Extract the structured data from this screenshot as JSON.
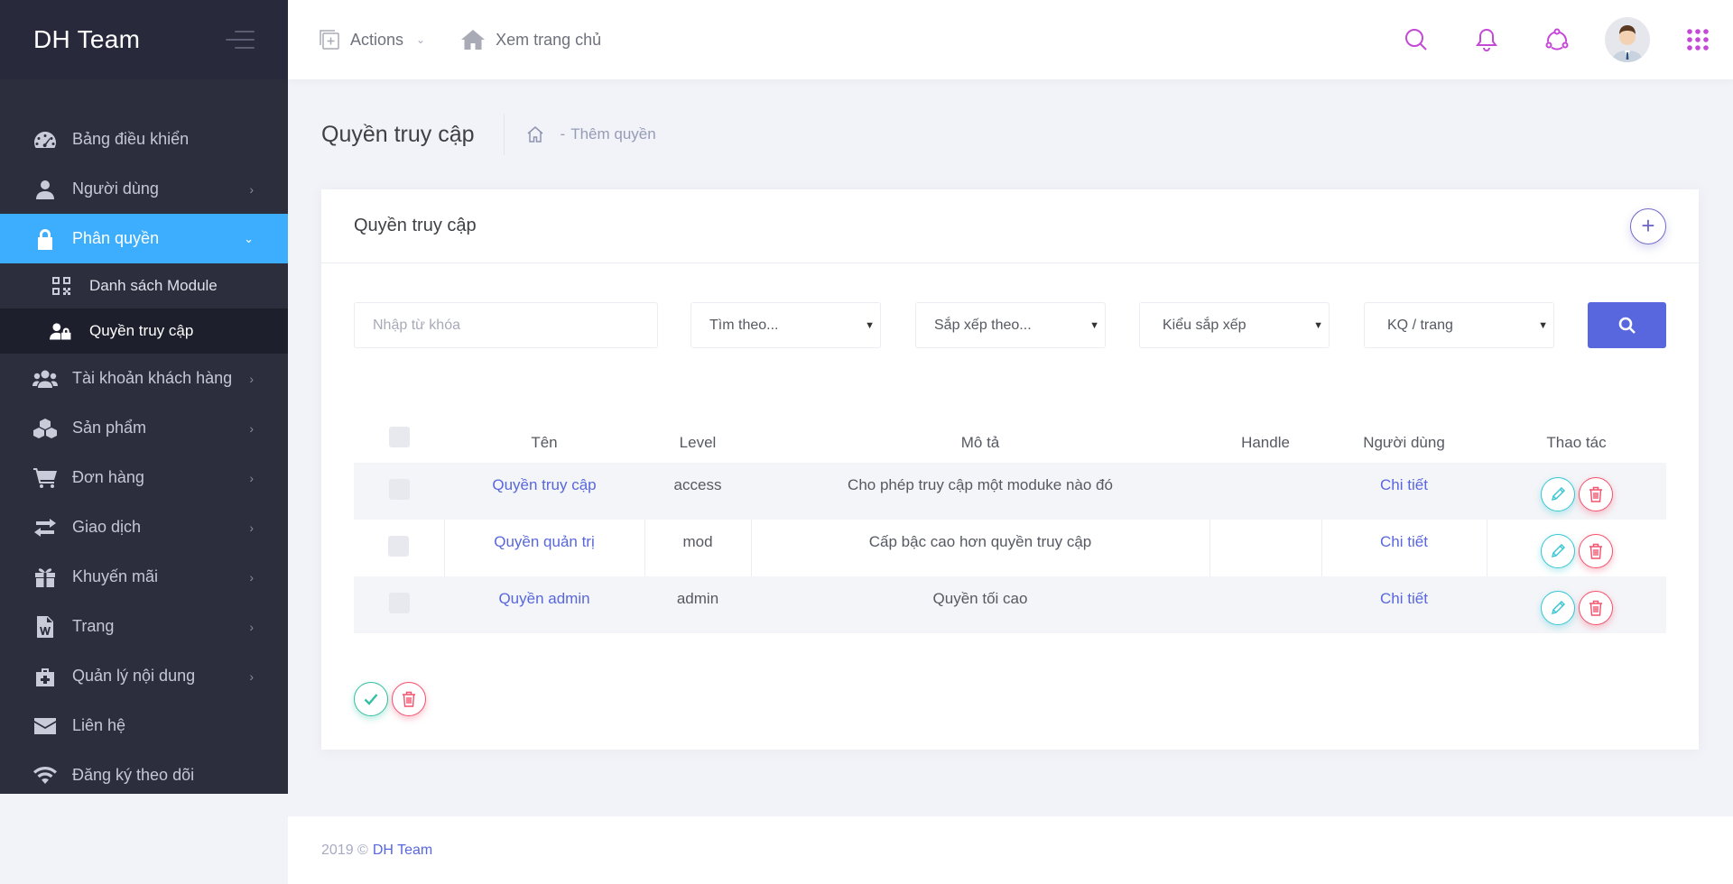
{
  "brand": {
    "name": "DH Team"
  },
  "header": {
    "actions_label": "Actions",
    "home_link_label": "Xem trang chủ"
  },
  "sidebar": {
    "items": [
      {
        "label": "Bảng điều khiển",
        "icon": "dashboard-icon",
        "has_arrow": false
      },
      {
        "label": "Người dùng",
        "icon": "user-icon",
        "has_arrow": true
      },
      {
        "label": "Phân quyền",
        "icon": "lock-icon",
        "has_arrow": true,
        "active": true,
        "children": [
          {
            "label": "Danh sách Module",
            "icon": "qrcode-icon"
          },
          {
            "label": "Quyền truy cập",
            "icon": "user-lock-icon",
            "active": true
          }
        ]
      },
      {
        "label": "Tài khoản khách hàng",
        "icon": "users-icon",
        "has_arrow": true
      },
      {
        "label": "Sản phẩm",
        "icon": "cubes-icon",
        "has_arrow": true
      },
      {
        "label": "Đơn hàng",
        "icon": "cart-icon",
        "has_arrow": true
      },
      {
        "label": "Giao dịch",
        "icon": "exchange-icon",
        "has_arrow": true
      },
      {
        "label": "Khuyến mãi",
        "icon": "gift-icon",
        "has_arrow": true
      },
      {
        "label": "Trang",
        "icon": "word-file-icon",
        "has_arrow": true
      },
      {
        "label": "Quản lý nội dung",
        "icon": "medkit-icon",
        "has_arrow": true
      },
      {
        "label": "Liên hệ",
        "icon": "envelope-icon",
        "has_arrow": false
      },
      {
        "label": "Đăng ký theo dõi",
        "icon": "wifi-icon",
        "has_arrow": false
      }
    ]
  },
  "subheader": {
    "title": "Quyền truy cập",
    "separator": "-",
    "breadcrumb": "Thêm quyền"
  },
  "portlet": {
    "title": "Quyền truy cập",
    "add_symbol": "+"
  },
  "filters": {
    "keyword_placeholder": "Nhập từ khóa",
    "search_by": "Tìm theo...",
    "sort_by": "Sắp xếp theo...",
    "sort_type": "Kiểu sắp xếp",
    "per_page": "KQ / trang"
  },
  "table": {
    "columns": [
      "Tên",
      "Level",
      "Mô tả",
      "Handle",
      "Người dùng",
      "Thao tác"
    ],
    "rows": [
      {
        "name": "Quyền truy cập",
        "level": "access",
        "description": "Cho phép truy cập một moduke nào đó",
        "handle": "",
        "users": "Chi tiết"
      },
      {
        "name": "Quyền quản trị",
        "level": "mod",
        "description": "Cấp bậc cao hơn quyền truy cập",
        "handle": "",
        "users": "Chi tiết"
      },
      {
        "name": "Quyền admin",
        "level": "admin",
        "description": "Quyền tối cao",
        "handle": "",
        "users": "Chi tiết"
      }
    ]
  },
  "footer": {
    "copyright": "2019 ©",
    "link": "DH Team"
  },
  "colors": {
    "sidebar_bg": "#2c2e3e",
    "active_item": "#3daefe",
    "primary": "#5867dd",
    "info": "#36c6d3",
    "danger": "#f4516c",
    "success": "#34bfa3",
    "header_icons": "#c449d6"
  }
}
